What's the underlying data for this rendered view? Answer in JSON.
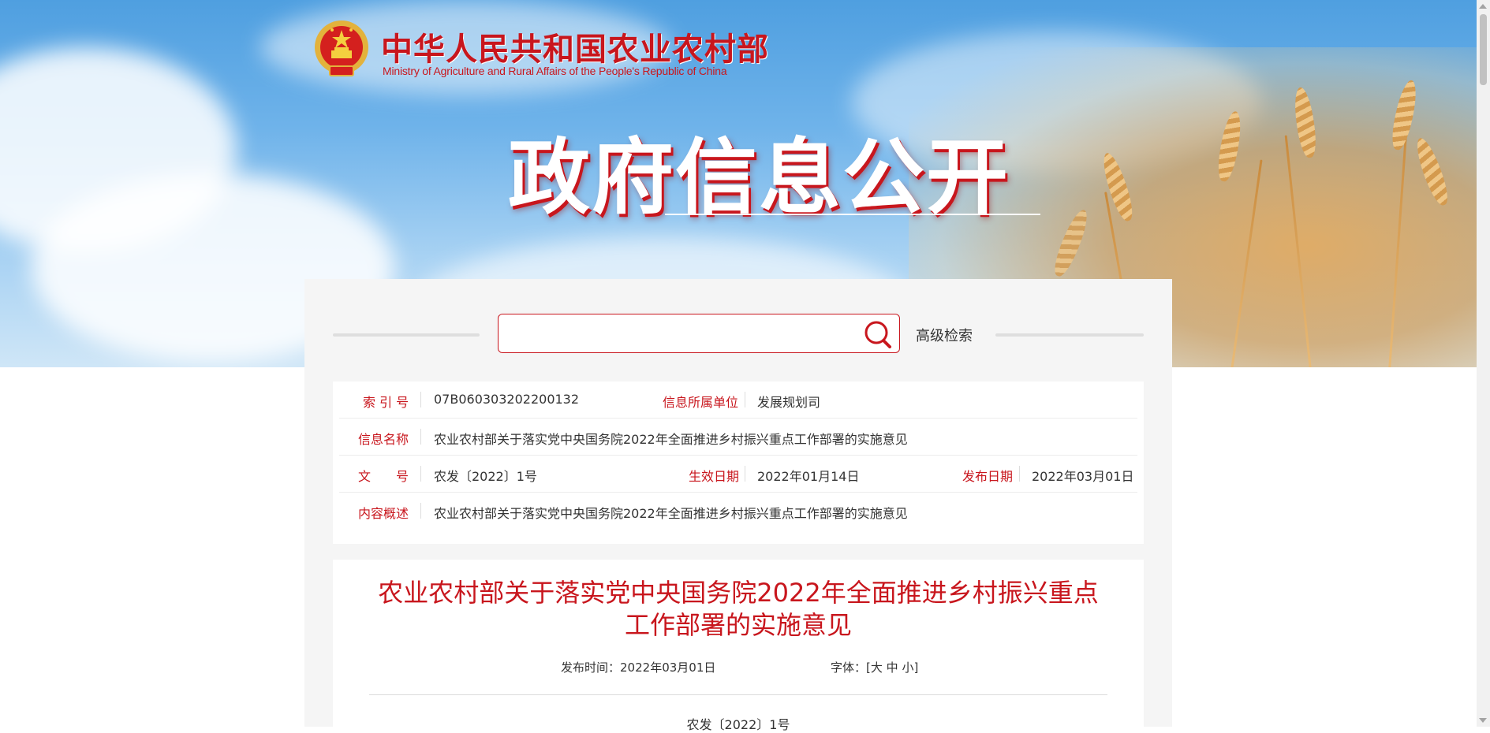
{
  "header": {
    "org_name_cn": "中华人民共和国农业农村部",
    "org_name_en": "Ministry of Agriculture and Rural Affairs of the People's Republic of China",
    "banner_title": "政府信息公开"
  },
  "search": {
    "placeholder": "",
    "value": "",
    "advanced_label": "高级检索",
    "search_icon": "search-icon"
  },
  "info": {
    "index_label": "索 引 号",
    "index_value": "07B060303202200132",
    "unit_label": "信息所属单位",
    "unit_value": "发展规划司",
    "name_label": "信息名称",
    "name_value": "农业农村部关于落实党中央国务院2022年全面推进乡村振兴重点工作部署的实施意见",
    "docno_label": "文　　号",
    "docno_value": "农发〔2022〕1号",
    "effective_label": "生效日期",
    "effective_value": "2022年01月14日",
    "publish_label": "发布日期",
    "publish_value": "2022年03月01日",
    "summary_label": "内容概述",
    "summary_value": "农业农村部关于落实党中央国务院2022年全面推进乡村振兴重点工作部署的实施意见"
  },
  "article": {
    "title_line1": "农业农村部关于落实党中央国务院2022年全面推进乡村振兴重点",
    "title_line2": "工作部署的实施意见",
    "publish_time_label": "发布时间：",
    "publish_time_value": "2022年03月01日",
    "font_label": "字体：",
    "font_open": "[",
    "font_large": "大",
    "font_medium": "中",
    "font_small": "小",
    "font_close": "]",
    "doc_number": "农发〔2022〕1号"
  },
  "colors": {
    "accent": "#c8161d",
    "panel_bg": "#f5f5f5"
  }
}
